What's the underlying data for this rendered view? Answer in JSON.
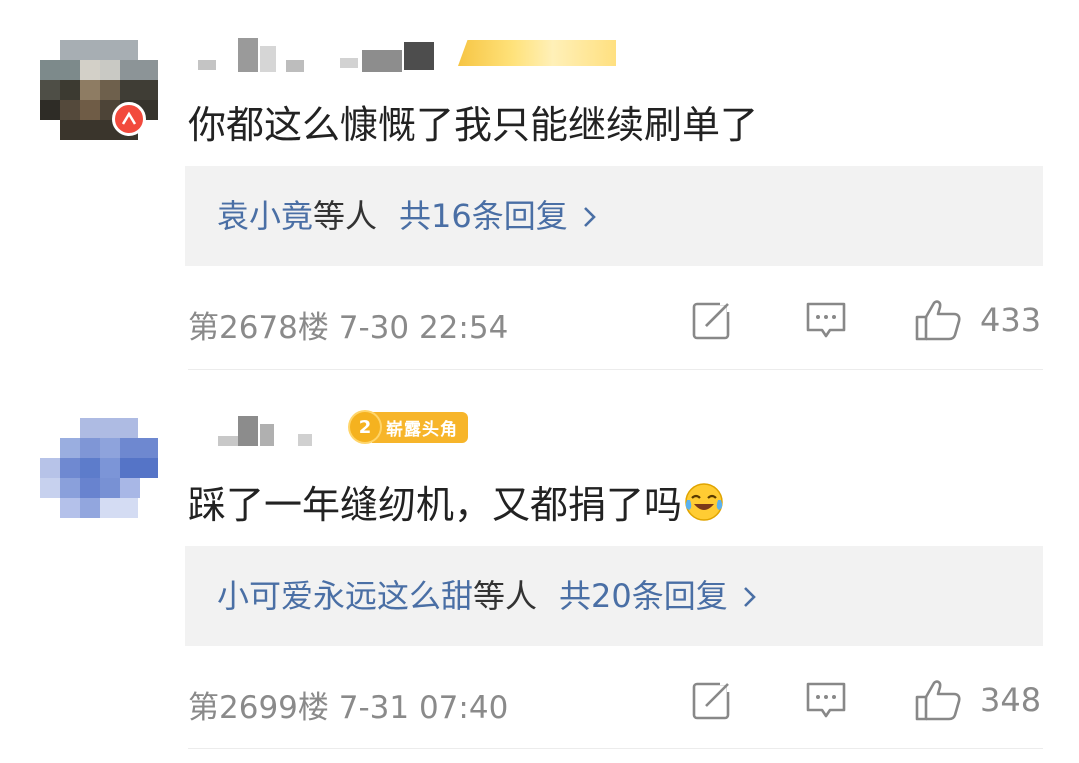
{
  "comments": [
    {
      "text": "你都这么慷慨了我只能继续刷单了",
      "replies": {
        "names": "袁小竟",
        "suffix": "等人",
        "count_text": "共16条回复"
      },
      "meta": "第2678楼 7-30 22:54",
      "likes": "433"
    },
    {
      "medal_level": "2",
      "medal_label": "崭露头角",
      "text": "踩了一年缝纫机，又都捐了吗",
      "replies": {
        "names": "小可爱永远这么甜",
        "suffix": "等人",
        "count_text": "共20条回复"
      },
      "meta": "第2699楼 7-31 07:40",
      "likes": "348"
    }
  ],
  "icons": {
    "share": "share-edit-icon",
    "comment": "comment-icon",
    "like": "thumbs-up-icon",
    "chevron": "chevron-right-icon",
    "emoji": "laughing-crying-emoji-icon"
  },
  "colors": {
    "link": "#4a6fa5",
    "meta": "#8a8a8a",
    "reply_bg": "#f2f2f2"
  }
}
